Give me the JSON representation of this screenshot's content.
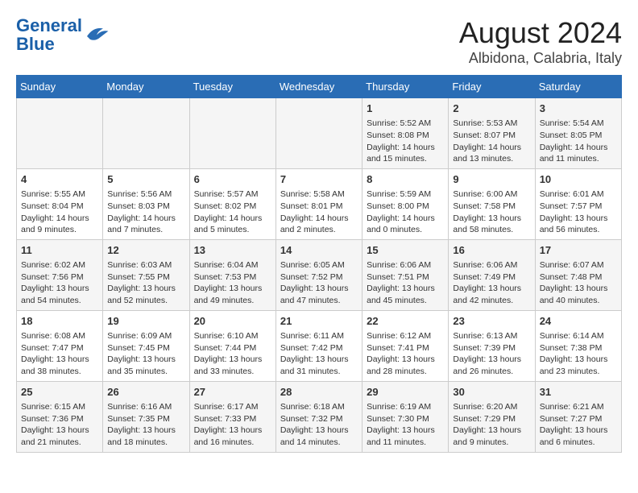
{
  "logo": {
    "line1": "General",
    "line2": "Blue"
  },
  "title": "August 2024",
  "subtitle": "Albidona, Calabria, Italy",
  "weekdays": [
    "Sunday",
    "Monday",
    "Tuesday",
    "Wednesday",
    "Thursday",
    "Friday",
    "Saturday"
  ],
  "weeks": [
    [
      {
        "day": "",
        "info": ""
      },
      {
        "day": "",
        "info": ""
      },
      {
        "day": "",
        "info": ""
      },
      {
        "day": "",
        "info": ""
      },
      {
        "day": "1",
        "info": "Sunrise: 5:52 AM\nSunset: 8:08 PM\nDaylight: 14 hours\nand 15 minutes."
      },
      {
        "day": "2",
        "info": "Sunrise: 5:53 AM\nSunset: 8:07 PM\nDaylight: 14 hours\nand 13 minutes."
      },
      {
        "day": "3",
        "info": "Sunrise: 5:54 AM\nSunset: 8:05 PM\nDaylight: 14 hours\nand 11 minutes."
      }
    ],
    [
      {
        "day": "4",
        "info": "Sunrise: 5:55 AM\nSunset: 8:04 PM\nDaylight: 14 hours\nand 9 minutes."
      },
      {
        "day": "5",
        "info": "Sunrise: 5:56 AM\nSunset: 8:03 PM\nDaylight: 14 hours\nand 7 minutes."
      },
      {
        "day": "6",
        "info": "Sunrise: 5:57 AM\nSunset: 8:02 PM\nDaylight: 14 hours\nand 5 minutes."
      },
      {
        "day": "7",
        "info": "Sunrise: 5:58 AM\nSunset: 8:01 PM\nDaylight: 14 hours\nand 2 minutes."
      },
      {
        "day": "8",
        "info": "Sunrise: 5:59 AM\nSunset: 8:00 PM\nDaylight: 14 hours\nand 0 minutes."
      },
      {
        "day": "9",
        "info": "Sunrise: 6:00 AM\nSunset: 7:58 PM\nDaylight: 13 hours\nand 58 minutes."
      },
      {
        "day": "10",
        "info": "Sunrise: 6:01 AM\nSunset: 7:57 PM\nDaylight: 13 hours\nand 56 minutes."
      }
    ],
    [
      {
        "day": "11",
        "info": "Sunrise: 6:02 AM\nSunset: 7:56 PM\nDaylight: 13 hours\nand 54 minutes."
      },
      {
        "day": "12",
        "info": "Sunrise: 6:03 AM\nSunset: 7:55 PM\nDaylight: 13 hours\nand 52 minutes."
      },
      {
        "day": "13",
        "info": "Sunrise: 6:04 AM\nSunset: 7:53 PM\nDaylight: 13 hours\nand 49 minutes."
      },
      {
        "day": "14",
        "info": "Sunrise: 6:05 AM\nSunset: 7:52 PM\nDaylight: 13 hours\nand 47 minutes."
      },
      {
        "day": "15",
        "info": "Sunrise: 6:06 AM\nSunset: 7:51 PM\nDaylight: 13 hours\nand 45 minutes."
      },
      {
        "day": "16",
        "info": "Sunrise: 6:06 AM\nSunset: 7:49 PM\nDaylight: 13 hours\nand 42 minutes."
      },
      {
        "day": "17",
        "info": "Sunrise: 6:07 AM\nSunset: 7:48 PM\nDaylight: 13 hours\nand 40 minutes."
      }
    ],
    [
      {
        "day": "18",
        "info": "Sunrise: 6:08 AM\nSunset: 7:47 PM\nDaylight: 13 hours\nand 38 minutes."
      },
      {
        "day": "19",
        "info": "Sunrise: 6:09 AM\nSunset: 7:45 PM\nDaylight: 13 hours\nand 35 minutes."
      },
      {
        "day": "20",
        "info": "Sunrise: 6:10 AM\nSunset: 7:44 PM\nDaylight: 13 hours\nand 33 minutes."
      },
      {
        "day": "21",
        "info": "Sunrise: 6:11 AM\nSunset: 7:42 PM\nDaylight: 13 hours\nand 31 minutes."
      },
      {
        "day": "22",
        "info": "Sunrise: 6:12 AM\nSunset: 7:41 PM\nDaylight: 13 hours\nand 28 minutes."
      },
      {
        "day": "23",
        "info": "Sunrise: 6:13 AM\nSunset: 7:39 PM\nDaylight: 13 hours\nand 26 minutes."
      },
      {
        "day": "24",
        "info": "Sunrise: 6:14 AM\nSunset: 7:38 PM\nDaylight: 13 hours\nand 23 minutes."
      }
    ],
    [
      {
        "day": "25",
        "info": "Sunrise: 6:15 AM\nSunset: 7:36 PM\nDaylight: 13 hours\nand 21 minutes."
      },
      {
        "day": "26",
        "info": "Sunrise: 6:16 AM\nSunset: 7:35 PM\nDaylight: 13 hours\nand 18 minutes."
      },
      {
        "day": "27",
        "info": "Sunrise: 6:17 AM\nSunset: 7:33 PM\nDaylight: 13 hours\nand 16 minutes."
      },
      {
        "day": "28",
        "info": "Sunrise: 6:18 AM\nSunset: 7:32 PM\nDaylight: 13 hours\nand 14 minutes."
      },
      {
        "day": "29",
        "info": "Sunrise: 6:19 AM\nSunset: 7:30 PM\nDaylight: 13 hours\nand 11 minutes."
      },
      {
        "day": "30",
        "info": "Sunrise: 6:20 AM\nSunset: 7:29 PM\nDaylight: 13 hours\nand 9 minutes."
      },
      {
        "day": "31",
        "info": "Sunrise: 6:21 AM\nSunset: 7:27 PM\nDaylight: 13 hours\nand 6 minutes."
      }
    ]
  ]
}
